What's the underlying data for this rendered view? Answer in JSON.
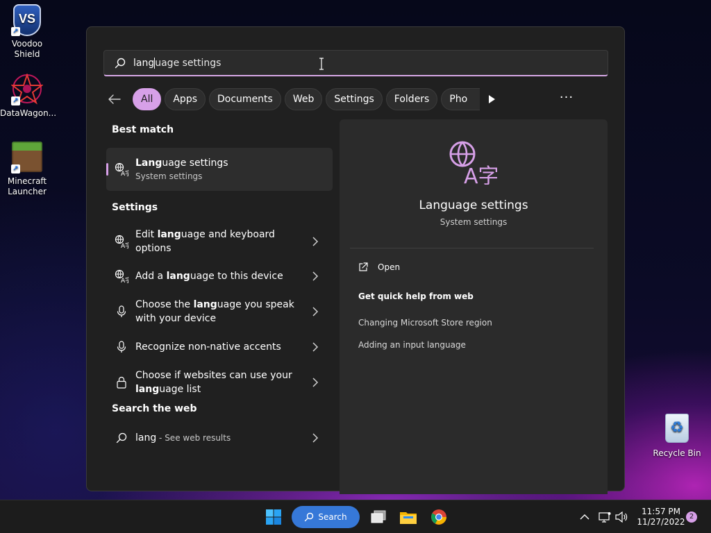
{
  "desktop": {
    "icons": [
      {
        "label_line1": "Voodoo",
        "label_line2": "Shield",
        "badge": "VS"
      },
      {
        "label_line1": "DataWagon...",
        "label_line2": ""
      },
      {
        "label_line1": "Minecraft",
        "label_line2": "Launcher"
      },
      {
        "label_line1": "Recycle Bin",
        "label_line2": ""
      }
    ]
  },
  "search": {
    "typed": "lang",
    "completion": "uage settings"
  },
  "filters": {
    "chips": [
      "All",
      "Apps",
      "Documents",
      "Web",
      "Settings",
      "Folders",
      "Pho"
    ],
    "active_index": 0,
    "more_label": "···"
  },
  "best_match": {
    "heading": "Best match",
    "title_bold": "Lang",
    "title_rest": "uage settings",
    "subtitle": "System settings"
  },
  "settings_section": {
    "heading": "Settings",
    "items": [
      {
        "pre": "Edit ",
        "bold": "lang",
        "post": "uage and keyboard options",
        "icon": "language-icon"
      },
      {
        "pre": "Add a ",
        "bold": "lang",
        "post": "uage to this device",
        "icon": "language-icon"
      },
      {
        "pre": "Choose the ",
        "bold": "lang",
        "post": "uage you speak with your device",
        "icon": "microphone-icon"
      },
      {
        "pre": "Recognize non-native accents",
        "bold": "",
        "post": "",
        "icon": "microphone-icon"
      },
      {
        "pre": "Choose if websites can use your ",
        "bold": "lang",
        "post": "uage list",
        "icon": "lock-icon"
      }
    ]
  },
  "web_section": {
    "heading": "Search the web",
    "query": "lang",
    "suffix": " - See web results"
  },
  "preview": {
    "title": "Language settings",
    "subtitle": "System settings",
    "open_label": "Open",
    "help_heading": "Get quick help from web",
    "help_links": [
      "Changing Microsoft Store region",
      "Adding an input language"
    ]
  },
  "taskbar": {
    "search_label": "Search",
    "time": "11:57 PM",
    "date": "11/27/2022",
    "notification_count": "2"
  },
  "colors": {
    "accent": "#d7a0e8",
    "taskbar_search": "#3678d8",
    "panel_bg": "#202020"
  }
}
